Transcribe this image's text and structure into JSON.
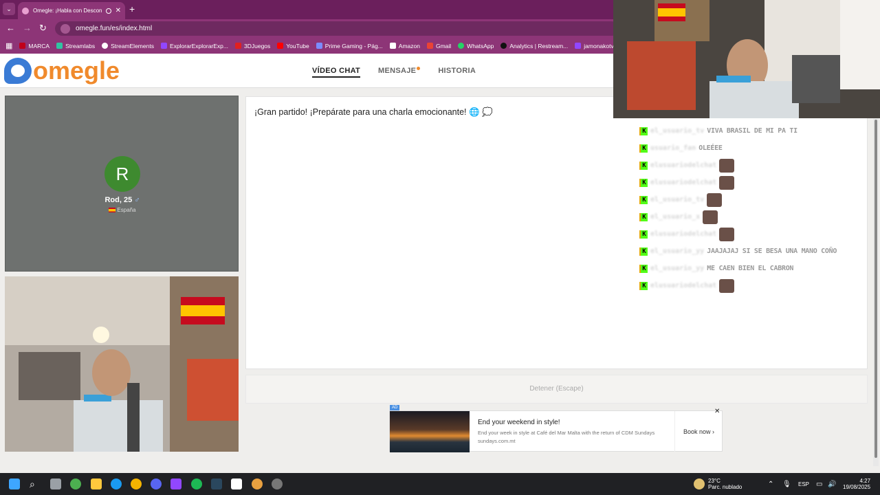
{
  "browser": {
    "tab_title": "Omegle: ¡Habla con Descon",
    "url": "omegle.fun/es/index.html",
    "bookmarks": [
      "MARCA",
      "Streamlabs",
      "StreamElements",
      "ExplorarExplorarExp...",
      "3DJuegos",
      "YouTube",
      "Prime Gaming - Pág...",
      "Amazon",
      "Gmail",
      "WhatsApp",
      "Analytics | Restream...",
      "jamonakotv - T"
    ]
  },
  "site": {
    "logo": "omegle",
    "nav": [
      "VÍDEO CHAT",
      "MENSAJE",
      "HISTORIA"
    ]
  },
  "stranger": {
    "initial": "R",
    "name": "Rod, 25",
    "country": "España"
  },
  "chat": {
    "message": "¡Gran partido! ¡Prepárate para una charla emocionante! 🌐 💭",
    "stop_label": "Detener (Escape)"
  },
  "ad": {
    "badge": "AD",
    "title": "End your weekend in style!",
    "description": "End your week in style at Café del Mar Malta with the return of CDM Sundays",
    "url": "sundays.com.mt",
    "cta": "Book now"
  },
  "stream_chat": [
    {
      "user": "el_usuario_tv",
      "text": "VIVA BRASIL DE MI PA TI",
      "emote": false
    },
    {
      "user": "usuario_fan",
      "text": "OLEÉEE",
      "emote": false
    },
    {
      "user": "elusuariodelchat",
      "text": "",
      "emote": true
    },
    {
      "user": "elusuariodelchat",
      "text": "",
      "emote": true
    },
    {
      "user": "el_usuario_tv",
      "text": "",
      "emote": true
    },
    {
      "user": "el_usuario_x",
      "text": "",
      "emote": true
    },
    {
      "user": "elusuariodelchat",
      "text": "",
      "emote": true
    },
    {
      "user": "el_usuario_yy",
      "text": "JAAJAJAJ SI SE BESA UNA MANO COÑO",
      "emote": false
    },
    {
      "user": "el_usuario_yy",
      "text": "ME CAEN BIEN EL CABRON",
      "emote": false
    },
    {
      "user": "elusuariodelchat",
      "text": "",
      "emote": true
    }
  ],
  "taskbar": {
    "weather_temp": "23°C",
    "weather_desc": "Parc. nublado",
    "language": "ESP",
    "time": "4:27",
    "date": "19/08/2025"
  }
}
